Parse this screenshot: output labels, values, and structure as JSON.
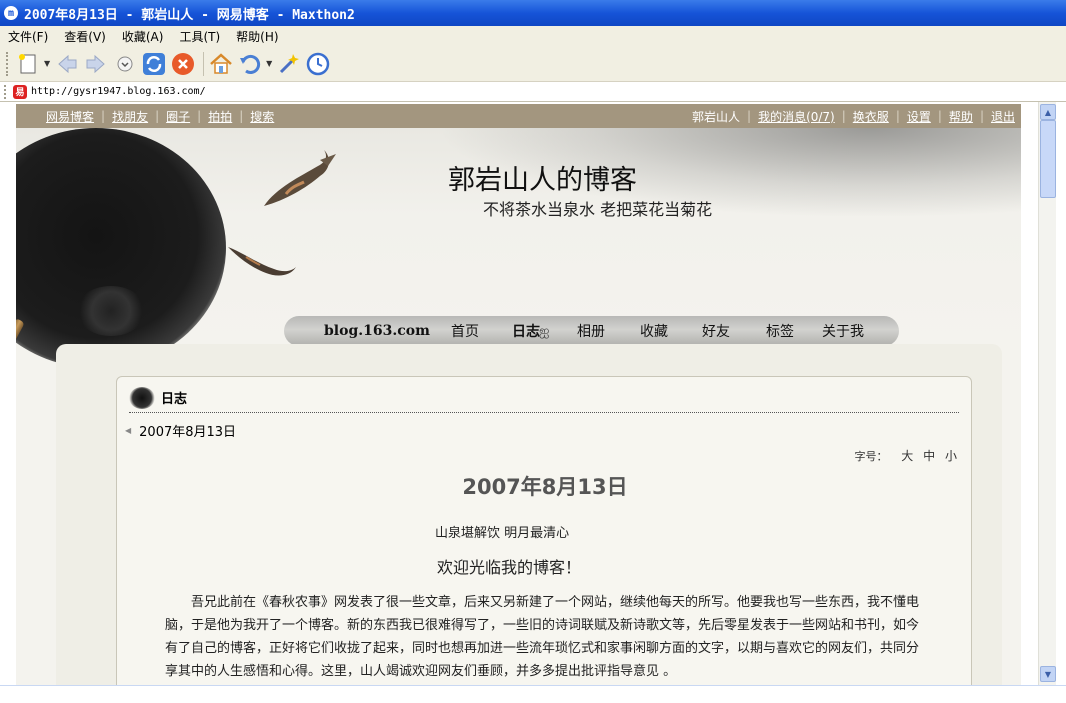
{
  "window": {
    "title": "2007年8月13日 - 郭岩山人 - 网易博客 - Maxthon2"
  },
  "menu": [
    "文件(F)",
    "查看(V)",
    "收藏(A)",
    "工具(T)",
    "帮助(H)"
  ],
  "toolbar": {
    "icons": [
      "new-page",
      "back",
      "forward",
      "history-dropdown",
      "refresh",
      "stop",
      "home",
      "undo",
      "magic-wand",
      "clock"
    ]
  },
  "address": {
    "url": "http://gysr1947.blog.163.com/"
  },
  "topnav": {
    "left": [
      "网易博客",
      "找朋友",
      "圈子",
      "拍拍",
      "搜索"
    ],
    "user": "郭岩山人",
    "right": [
      "我的消息(0/7)",
      "换衣服",
      "设置",
      "帮助",
      "退出"
    ]
  },
  "header": {
    "title": "郭岩山人的博客",
    "subtitle": "不将茶水当泉水 老把菜花当菊花"
  },
  "mainnav": {
    "brand": "blog.163.com",
    "items": [
      "首页",
      "日志",
      "相册",
      "收藏",
      "好友",
      "标签",
      "关于我"
    ],
    "active": "日志"
  },
  "card": {
    "heading": "日志",
    "crumb": "2007年8月13日",
    "font_size_label": "字号：",
    "font_sizes": [
      "大",
      "中",
      "小"
    ],
    "post_title": "2007年8月13日",
    "post_sub": "山泉堪解饮 明月最清心",
    "post_welcome": "欢迎光临我的博客！",
    "post_body": "吾兄此前在《春秋农事》网发表了很一些文章，后来又另新建了一个网站，继续他每天的所写。他要我也写一些东西，我不懂电脑，于是他为我开了一个博客。新的东西我已很难得写了，一些旧的诗词联赋及新诗歌文等，先后零星发表于一些网站和书刊，如今有了自己的博客，正好将它们收拢了起来，同时也想再加进一些流年琐忆式和家事闲聊方面的文字，以期与喜欢它的网友们，共同分享其中的人生感悟和心得。这里，山人竭诚欢迎网友们垂顾，并多多提出批评指导意见 。"
  }
}
